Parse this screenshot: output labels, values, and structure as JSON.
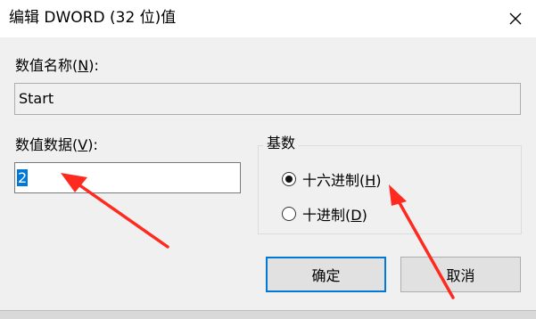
{
  "window": {
    "title": "编辑 DWORD (32 位)值",
    "close_glyph": "✕"
  },
  "value_name": {
    "label": "数值名称(",
    "mnemonic": "N",
    "label_suffix": "):",
    "value": "Start"
  },
  "value_data": {
    "label": "数值数据(",
    "mnemonic": "V",
    "label_suffix": "):",
    "value": "2"
  },
  "base": {
    "title": "基数",
    "options": [
      {
        "label": "十六进制(",
        "mnemonic": "H",
        "suffix": ")",
        "checked": true
      },
      {
        "label": "十进制(",
        "mnemonic": "D",
        "suffix": ")",
        "checked": false
      }
    ]
  },
  "buttons": {
    "ok": "确定",
    "cancel": "取消"
  },
  "colors": {
    "accent": "#0078d7",
    "annotation_arrow": "#ff2a1f"
  }
}
